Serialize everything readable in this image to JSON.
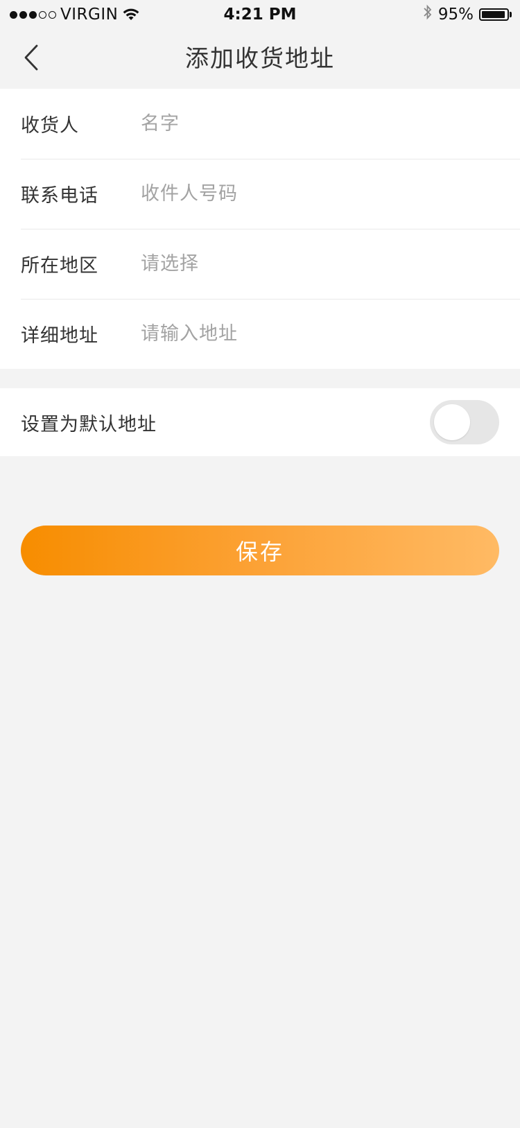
{
  "status_bar": {
    "carrier": "VIRGIN",
    "time": "4:21 PM",
    "battery": "95%",
    "battery_level": 0.95,
    "icons": [
      "signal-dots-icon",
      "wifi-icon",
      "bluetooth-icon",
      "battery-icon"
    ]
  },
  "nav": {
    "back_icon": "chevron-left-icon",
    "title": "添加收货地址"
  },
  "form": {
    "rows": [
      {
        "label": "收货人",
        "value": "",
        "placeholder": "名字"
      },
      {
        "label": "联系电话",
        "value": "",
        "placeholder": "收件人号码"
      },
      {
        "label": "所在地区",
        "value": "",
        "placeholder": "请选择"
      },
      {
        "label": "详细地址",
        "value": "",
        "placeholder": "请输入地址"
      }
    ]
  },
  "default_address": {
    "label": "设置为默认地址",
    "enabled": false
  },
  "save_button": {
    "label": "保存"
  },
  "colors": {
    "background": "#f3f3f3",
    "card": "#ffffff",
    "text": "#333333",
    "placeholder": "#a3a3a3",
    "divider": "#e9e9e9",
    "toggle_off": "#e6e6e6",
    "accent_start": "#f78d00",
    "accent_end": "#ffba64"
  }
}
